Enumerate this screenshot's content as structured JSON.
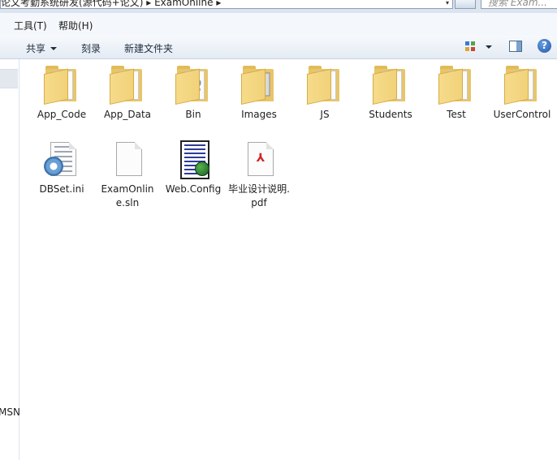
{
  "address": {
    "path": "论文考勤系统研发(源代码+论文) ▸ ExamOnline ▸"
  },
  "search": {
    "placeholder": "搜索 Exam..."
  },
  "menubar": {
    "tools_label": "工具(T)",
    "help_label": "帮助(H)"
  },
  "commandbar": {
    "share_label": "共享",
    "burn_label": "刻录",
    "new_folder_label": "新建文件夹"
  },
  "navpane": {
    "partial_item": "MSN"
  },
  "files": [
    {
      "name": "App_Code",
      "type": "folder",
      "icon": "folder-icon"
    },
    {
      "name": "App_Data",
      "type": "folder",
      "icon": "folder-icon"
    },
    {
      "name": "Bin",
      "type": "folder",
      "icon": "folder-gears-icon"
    },
    {
      "name": "Images",
      "type": "folder",
      "icon": "folder-images-icon"
    },
    {
      "name": "JS",
      "type": "folder",
      "icon": "folder-doc-icon"
    },
    {
      "name": "Students",
      "type": "folder",
      "icon": "folder-icon"
    },
    {
      "name": "Test",
      "type": "folder",
      "icon": "folder-icon"
    },
    {
      "name": "UserControl",
      "type": "folder",
      "icon": "folder-icon"
    },
    {
      "name": "DBSet.ini",
      "type": "ini",
      "icon": "config-settings-icon"
    },
    {
      "name": "ExamOnline.sln",
      "type": "sln",
      "icon": "blank-document-icon"
    },
    {
      "name": "Web.Config",
      "type": "config",
      "icon": "web-config-icon"
    },
    {
      "name": "毕业设计说明.pdf",
      "type": "pdf",
      "icon": "pdf-icon"
    }
  ],
  "colors": {
    "folder": "#f1d27a",
    "toolbar_top": "#f7f9fc",
    "toolbar_bottom": "#e4ebf4",
    "help": "#1d56a8",
    "pdf": "#d32222"
  }
}
